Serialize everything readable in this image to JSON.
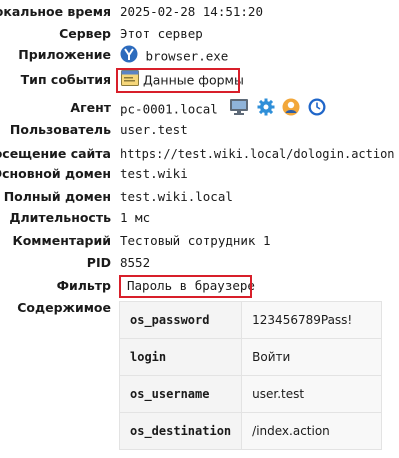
{
  "labels": {
    "local_time": "Локальное время",
    "server": "Сервер",
    "application": "Приложение",
    "event_type": "Тип события",
    "agent": "Агент",
    "user": "Пользователь",
    "site_visit": "Посещение сайта",
    "primary_domain": "Основной домен",
    "full_domain": "Полный домен",
    "duration": "Длительность",
    "comment": "Комментарий",
    "pid": "PID",
    "filter": "Фильтр",
    "content": "Содержимое"
  },
  "values": {
    "local_time": "2025-02-28 14:51:20",
    "server": "Этот сервер",
    "application": "browser.exe",
    "event_type": "Данные формы",
    "agent": "pc-0001.local",
    "user": "user.test",
    "site_visit": "https://test.wiki.local/dologin.action",
    "primary_domain": "test.wiki",
    "full_domain": "test.wiki.local",
    "duration": "1 мс",
    "comment": "Тестовый сотрудник 1",
    "pid": "8552",
    "filter": "Пароль в браузере"
  },
  "content_rows": [
    {
      "key": "os_password",
      "value": "123456789Pass!"
    },
    {
      "key": "login",
      "value": "Войти"
    },
    {
      "key": "os_username",
      "value": "user.test"
    },
    {
      "key": "os_destination",
      "value": "/index.action"
    }
  ],
  "icons": {
    "application": "browser-icon",
    "event_type": "form-data-icon",
    "agent": [
      "computer-icon",
      "gear-icon",
      "user-icon",
      "clock-icon"
    ]
  },
  "colors": {
    "highlight_border": "#d81f2a",
    "browser_icon": "#2d6bbd",
    "gear_icon": "#2f8fd8",
    "user_icon": "#f2a73a",
    "clock_icon": "#1f66c9"
  }
}
